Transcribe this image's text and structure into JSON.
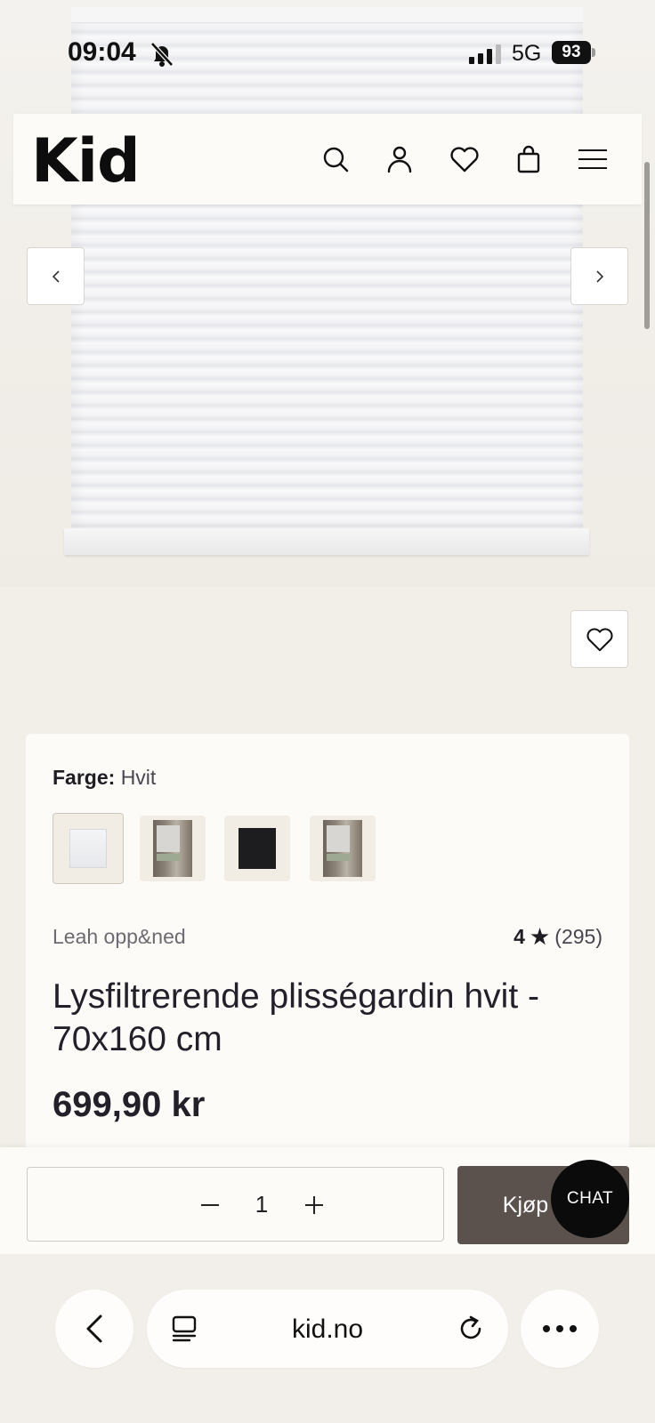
{
  "status_bar": {
    "time": "09:04",
    "network": "5G",
    "battery": "93"
  },
  "header": {
    "logo": "Kid",
    "icons": [
      "search-icon",
      "account-icon",
      "heart-icon",
      "bag-icon",
      "menu-icon"
    ]
  },
  "gallery": {
    "prev": "‹",
    "next": "›"
  },
  "product": {
    "color_label": "Farge:",
    "color_value": "Hvit",
    "swatches": [
      "white",
      "room-scene",
      "black",
      "room-scene"
    ],
    "brand": "Leah opp&ned",
    "rating_value": "4",
    "rating_star": "★",
    "rating_count": "(295)",
    "title": "Lysfiltrerende plisségardin hvit - 70x160 cm",
    "price": "699,90 kr"
  },
  "buy_bar": {
    "quantity": "1",
    "buy_label": "Kjøp",
    "chat_label": "CHAT"
  },
  "browser": {
    "url": "kid.no"
  },
  "colors": {
    "background": "#f2eee8",
    "card": "#fcfbf8",
    "buy_button": "#5b524d",
    "chat_button": "#0b0b0b"
  }
}
